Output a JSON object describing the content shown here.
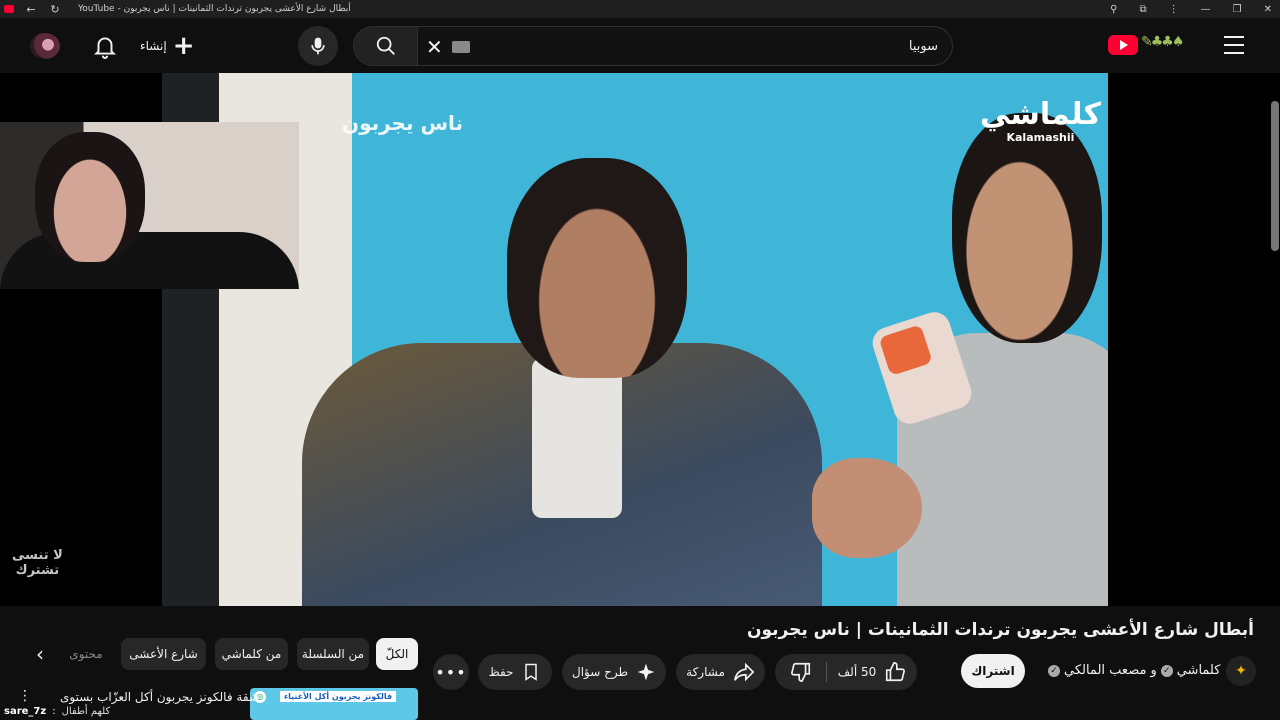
{
  "browser": {
    "tab_title": "YouTube - أبطال شارع الأعشى يجربون ترندات الثمانينات | ناس يجربون"
  },
  "header": {
    "create_label": "إنشاء",
    "search_value": "سوبيا",
    "search_placeholder": "بحث"
  },
  "player": {
    "watermark_ar": "كلماشي",
    "watermark_en": "Kalamashii",
    "overlay_text": "ناس يجربون",
    "reminder_line1": "لا تنسى",
    "reminder_line2": "تشترك"
  },
  "video": {
    "title": "أبطال شارع الأعشى يجربون ترندات الثمانينات | ناس يجربون",
    "channel_1": "كلماشي",
    "channel_joiner": "و",
    "channel_2": "مصعب المالكي",
    "subscribe_label": "اشتراك",
    "like_count": "50 ألف",
    "share_label": "مشاركة",
    "ask_label": "طرح سؤال",
    "save_label": "حفظ"
  },
  "chips": [
    {
      "label": "الكلّ"
    },
    {
      "label": "من السلسلة"
    },
    {
      "label": "من كلماشي"
    },
    {
      "label": "شارع الأعشى"
    },
    {
      "label": "محتوى"
    }
  ],
  "recommendation": {
    "thumb_banner": "فالكونز يجربون أكل الأغنياء",
    "title": "شقة فالكونز يجربون أكل العزّاب بستوى"
  },
  "chat": {
    "user": "sare_7z",
    "separator": ":",
    "message": "كلهم أطفال"
  },
  "colors": {
    "background": "#0f0f0f",
    "brand_red": "#ff0033",
    "pill_bg": "#272727"
  }
}
